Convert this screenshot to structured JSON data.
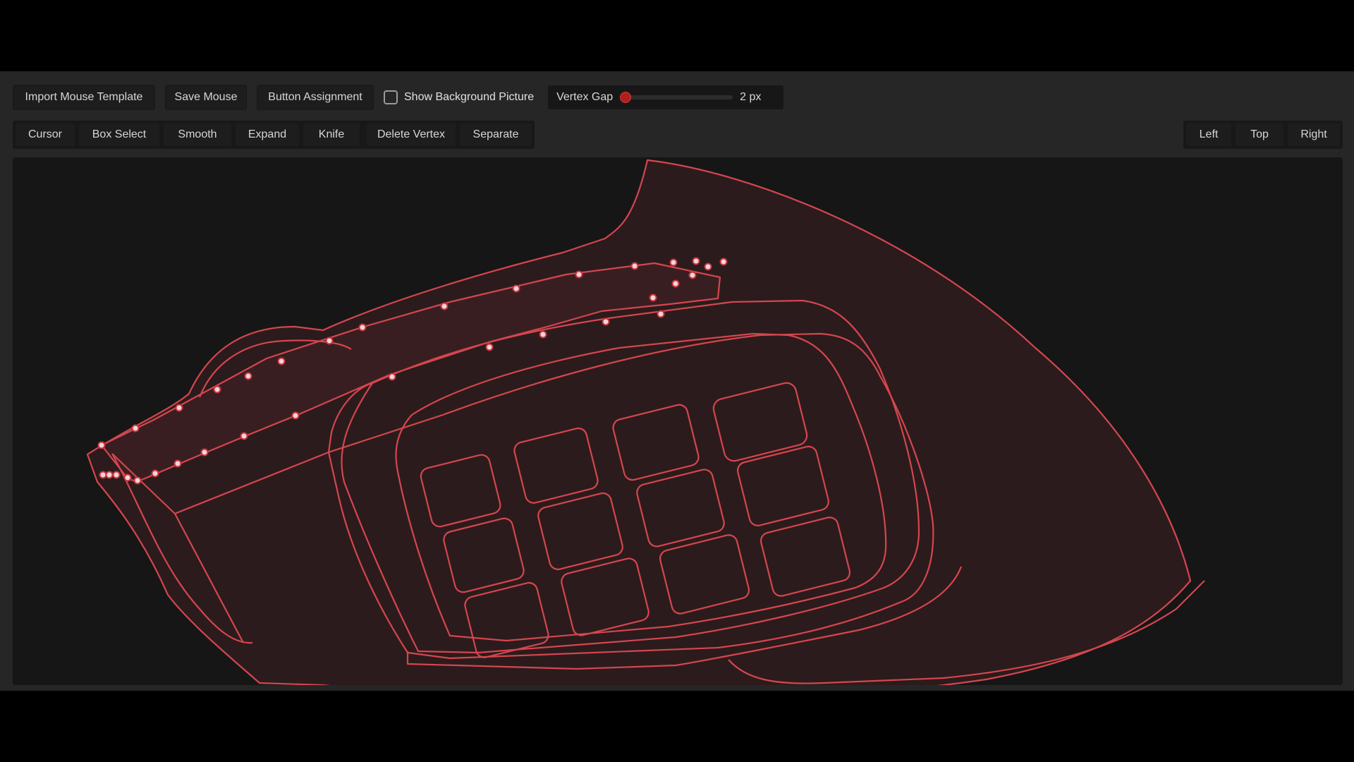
{
  "toolbar_top": {
    "import_label": "Import Mouse Template",
    "save_label": "Save Mouse",
    "assign_label": "Button Assignment",
    "show_bg_label": "Show Background Picture",
    "show_bg_checked": false,
    "vertex_gap_label": "Vertex Gap",
    "vertex_gap_value": "2 px",
    "vertex_gap_fraction": 0.05
  },
  "tools": {
    "cursor": "Cursor",
    "box_select": "Box Select",
    "smooth": "Smooth",
    "expand": "Expand",
    "knife": "Knife",
    "delete_vertex": "Delete Vertex",
    "separate": "Separate"
  },
  "views": {
    "left": "Left",
    "top": "Top",
    "right": "Right"
  },
  "colors": {
    "accent": "#b01e1e",
    "outline": "#d4464f",
    "canvas_bg": "#161616",
    "shape_fill": "#2c1b1c"
  }
}
